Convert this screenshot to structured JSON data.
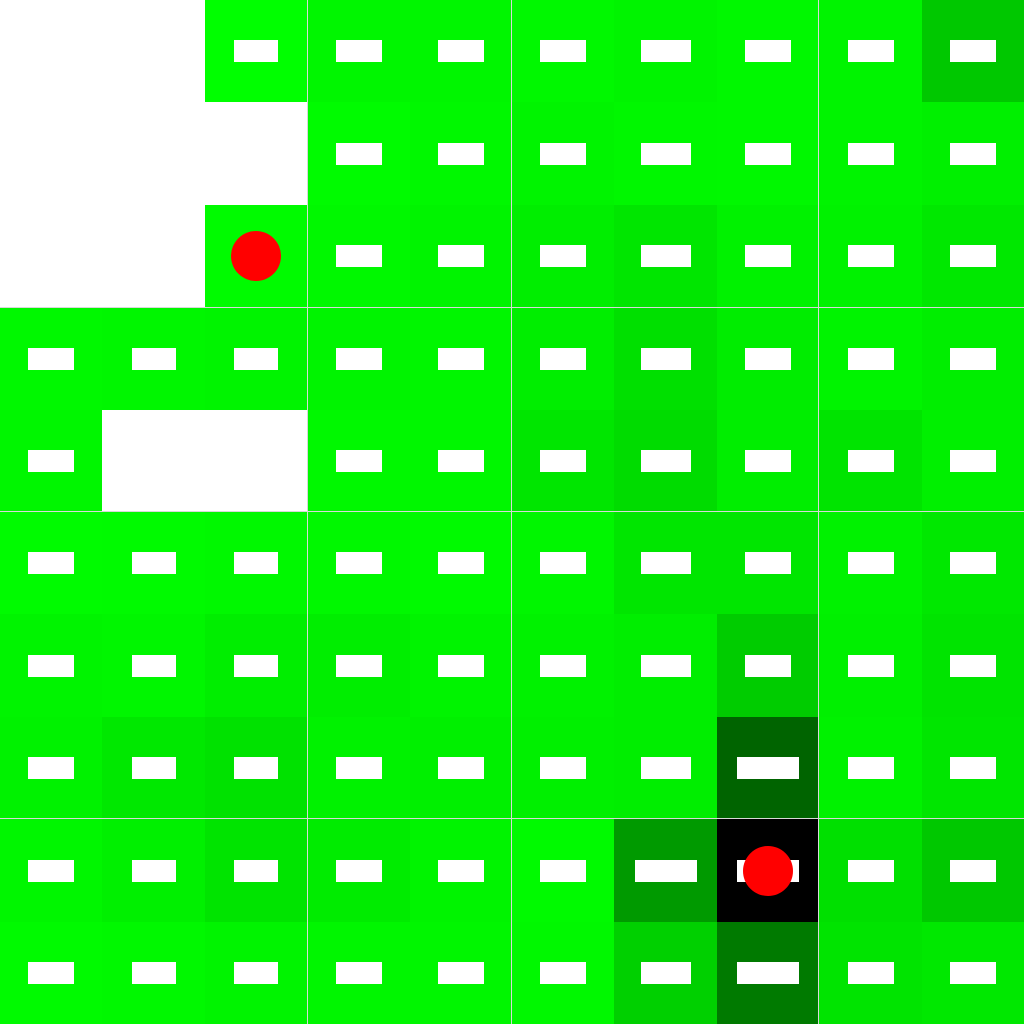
{
  "board": {
    "rows": 10,
    "cols": 10,
    "grid": [
      [
        "empty",
        "empty",
        "#00ff00",
        "#00f600",
        "#00f600",
        "#00f800",
        "#00f400",
        "#00f800",
        "#00f400",
        "#00c800"
      ],
      [
        "empty",
        "empty",
        "empty",
        "#00fb00",
        "#00f800",
        "#00f400",
        "#00f700",
        "#00f800",
        "#00f400",
        "#00f000"
      ],
      [
        "empty",
        "empty",
        "#00fb00",
        "#00f800",
        "#00f400",
        "#00ee00",
        "#00e600",
        "#00f200",
        "#00f200",
        "#00e800"
      ],
      [
        "#00f800",
        "#00f600",
        "#00f400",
        "#00f400",
        "#00f600",
        "#00ee00",
        "#00e000",
        "#00ed00",
        "#00f400",
        "#00ee00"
      ],
      [
        "#00f600",
        "empty",
        "empty",
        "#00f800",
        "#00f700",
        "#00e600",
        "#00dc00",
        "#00ee00",
        "#00e400",
        "#00f000"
      ],
      [
        "#00fb00",
        "#00fa00",
        "#00f800",
        "#00f800",
        "#00fa00",
        "#00f600",
        "#00e600",
        "#00e600",
        "#00f200",
        "#00e800"
      ],
      [
        "#00f400",
        "#00f600",
        "#00ee00",
        "#00ee00",
        "#00f400",
        "#00f200",
        "#00ee00",
        "#00cc00",
        "#00f000",
        "#00e400"
      ],
      [
        "#00f200",
        "#00e800",
        "#00e200",
        "#00f200",
        "#00f000",
        "#00f000",
        "#00ee00",
        "#006400",
        "#00f200",
        "#00e600"
      ],
      [
        "#00f600",
        "#00f000",
        "#00e400",
        "#00ec00",
        "#00f400",
        "#00fa00",
        "#009a00",
        "#000000",
        "#00e000",
        "#00c800"
      ],
      [
        "#00fa00",
        "#00f800",
        "#00f400",
        "#00f600",
        "#00f600",
        "#00f800",
        "#00d000",
        "#007a00",
        "#00e400",
        "#00e800"
      ]
    ],
    "bars": [
      [
        0,
        0,
        1,
        1,
        1,
        1,
        1,
        1,
        1,
        1
      ],
      [
        0,
        0,
        0,
        1,
        1,
        1,
        1,
        1,
        1,
        1
      ],
      [
        0,
        0,
        0,
        1,
        1,
        1,
        1,
        1,
        1,
        1
      ],
      [
        1,
        1,
        1,
        1,
        1,
        1,
        1,
        1,
        1,
        1
      ],
      [
        1,
        0,
        0,
        1,
        1,
        1,
        1,
        1,
        1,
        1
      ],
      [
        1,
        1,
        1,
        1,
        1,
        1,
        1,
        1,
        1,
        1
      ],
      [
        1,
        1,
        1,
        1,
        1,
        1,
        1,
        1,
        1,
        1
      ],
      [
        1,
        1,
        1,
        1,
        1,
        1,
        1,
        1,
        1,
        1
      ],
      [
        1,
        1,
        1,
        1,
        1,
        1,
        1,
        1,
        1,
        1
      ],
      [
        1,
        1,
        1,
        1,
        1,
        1,
        1,
        1,
        1,
        1
      ]
    ],
    "markers": [
      {
        "row": 2,
        "col": 2,
        "icon": "red-dot-icon",
        "color": "#ff0000"
      },
      {
        "row": 8,
        "col": 7,
        "icon": "red-dot-icon",
        "color": "#ff0000"
      }
    ]
  }
}
